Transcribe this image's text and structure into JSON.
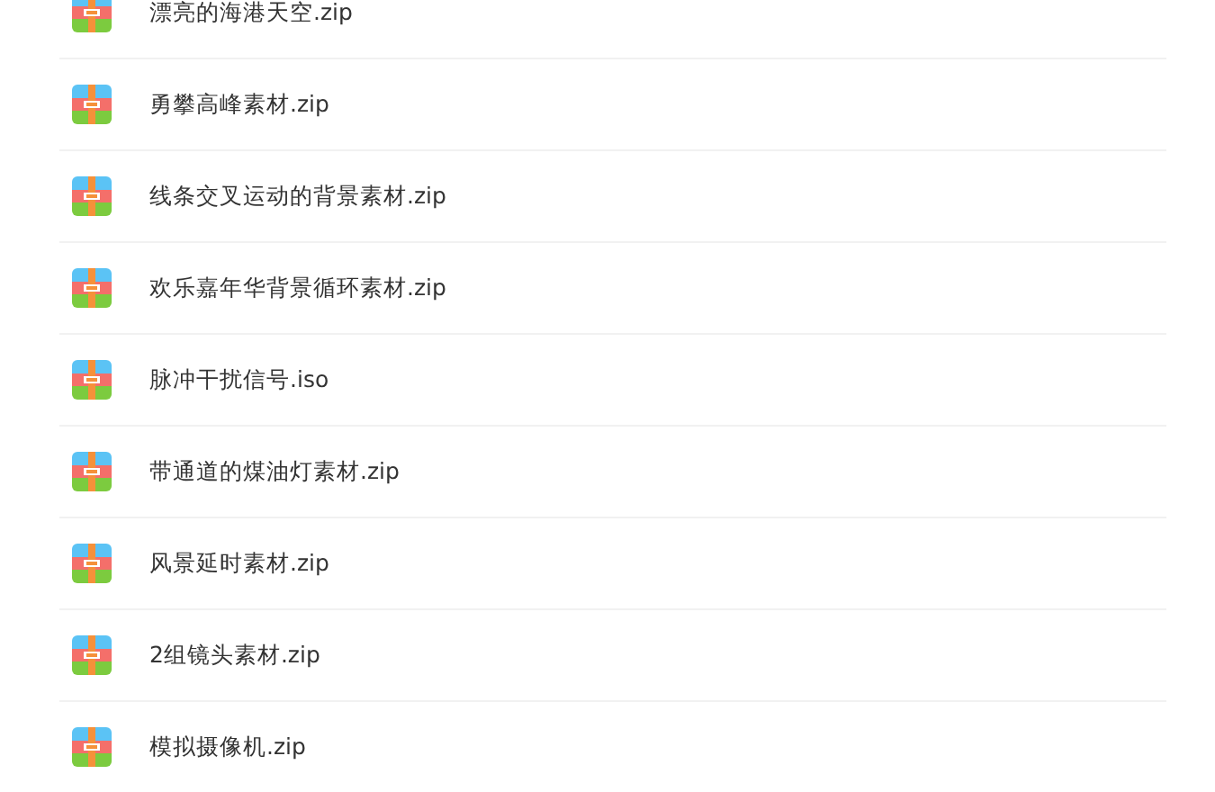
{
  "files": [
    {
      "name": "漂亮的海港天空.zip"
    },
    {
      "name": "勇攀高峰素材.zip"
    },
    {
      "name": "线条交叉运动的背景素材.zip"
    },
    {
      "name": "欢乐嘉年华背景循环素材.zip"
    },
    {
      "name": "脉冲干扰信号.iso"
    },
    {
      "name": "带通道的煤油灯素材.zip"
    },
    {
      "name": "风景延时素材.zip"
    },
    {
      "name": "2组镜头素材.zip"
    },
    {
      "name": "模拟摄像机.zip"
    }
  ]
}
